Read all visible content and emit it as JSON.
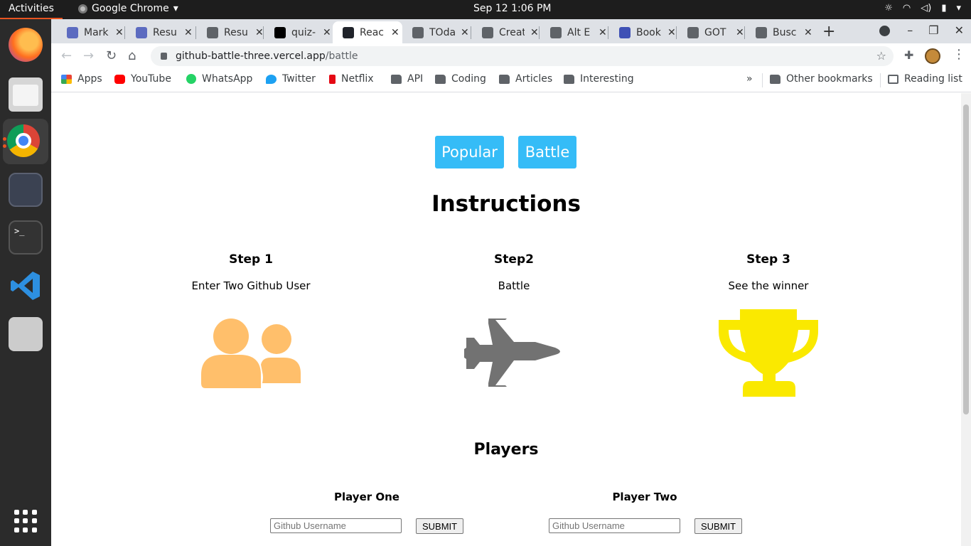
{
  "system": {
    "activities": "Activities",
    "app_name": "Google Chrome",
    "clock": "Sep 12  1:06 PM"
  },
  "tabs": [
    {
      "label": "Mark",
      "color": "#5c6bc0"
    },
    {
      "label": "Resu",
      "color": "#5c6bc0"
    },
    {
      "label": "Resu",
      "color": "#5f6368"
    },
    {
      "label": "quiz-",
      "color": "#000000"
    },
    {
      "label": "Reac",
      "color": "#20232a"
    },
    {
      "label": "TOda",
      "color": "#5f6368"
    },
    {
      "label": "Creat",
      "color": "#5f6368"
    },
    {
      "label": "Alt E",
      "color": "#5f6368"
    },
    {
      "label": "Book",
      "color": "#3f51b5"
    },
    {
      "label": "GOT",
      "color": "#5f6368"
    },
    {
      "label": "Busc",
      "color": "#5f6368"
    }
  ],
  "omnibox": {
    "domain": "github-battle-three.vercel.app",
    "path": "/battle"
  },
  "bookmarks": {
    "items": [
      "Apps",
      "YouTube",
      "WhatsApp",
      "Twitter",
      "Netflix",
      "API",
      "Coding",
      "Articles",
      "Interesting"
    ],
    "overflow": "»",
    "other": "Other bookmarks",
    "reading_list": "Reading list"
  },
  "page": {
    "nav": {
      "popular": "Popular",
      "battle": "Battle"
    },
    "instructions_title": "Instructions",
    "steps": [
      {
        "title": "Step 1",
        "desc": "Enter Two Github User",
        "icon": "users-icon",
        "color": "#ffbf6b"
      },
      {
        "title": "Step2",
        "desc": "Battle",
        "icon": "fighter-jet-icon",
        "color": "#727272"
      },
      {
        "title": "Step 3",
        "desc": "See the winner",
        "icon": "trophy-icon",
        "color": "#fae900"
      }
    ],
    "players_title": "Players",
    "player_one": {
      "label": "Player One",
      "placeholder": "Github Username",
      "submit": "SUBMIT"
    },
    "player_two": {
      "label": "Player Two",
      "placeholder": "Github Username",
      "submit": "SUBMIT"
    }
  },
  "colors": {
    "accent": "#35bcf7"
  }
}
